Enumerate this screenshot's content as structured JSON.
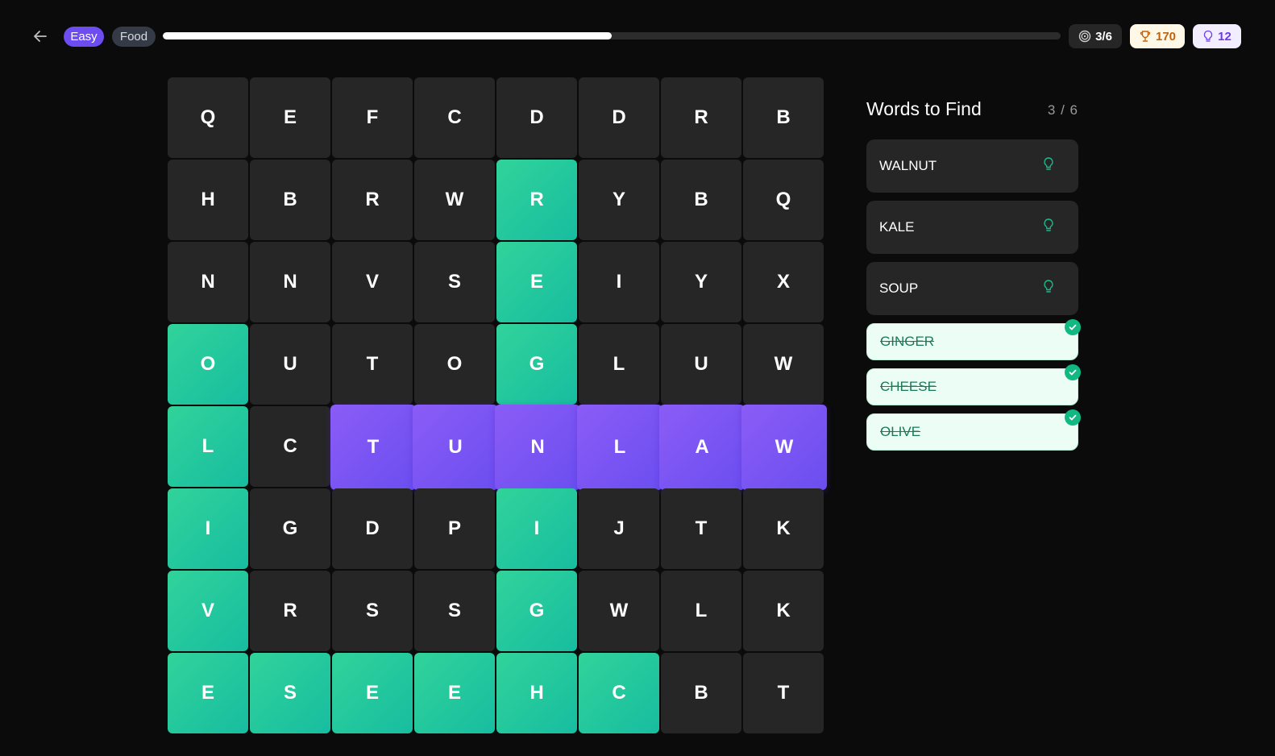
{
  "header": {
    "difficulty": "Easy",
    "category": "Food",
    "progress_fraction": 0.5,
    "found_count": "3/6",
    "score": "170",
    "hints": "12"
  },
  "grid": {
    "rows": [
      [
        "Q",
        "E",
        "F",
        "C",
        "D",
        "D",
        "R",
        "B"
      ],
      [
        "H",
        "B",
        "R",
        "W",
        "R",
        "Y",
        "B",
        "Q"
      ],
      [
        "N",
        "N",
        "V",
        "S",
        "E",
        "I",
        "Y",
        "X"
      ],
      [
        "O",
        "U",
        "T",
        "O",
        "G",
        "L",
        "U",
        "W"
      ],
      [
        "L",
        "C",
        "T",
        "U",
        "N",
        "L",
        "A",
        "W"
      ],
      [
        "I",
        "G",
        "D",
        "P",
        "I",
        "J",
        "T",
        "K"
      ],
      [
        "V",
        "R",
        "S",
        "S",
        "G",
        "W",
        "L",
        "K"
      ],
      [
        "E",
        "S",
        "E",
        "E",
        "H",
        "C",
        "B",
        "T"
      ]
    ],
    "found_cells": [
      [
        1,
        4
      ],
      [
        2,
        4
      ],
      [
        3,
        4
      ],
      [
        5,
        4
      ],
      [
        6,
        4
      ],
      [
        7,
        4
      ],
      [
        3,
        0
      ],
      [
        4,
        0
      ],
      [
        5,
        0
      ],
      [
        6,
        0
      ],
      [
        7,
        0
      ],
      [
        7,
        1
      ],
      [
        7,
        2
      ],
      [
        7,
        3
      ],
      [
        7,
        5
      ]
    ],
    "selected_cells": [
      [
        4,
        2
      ],
      [
        4,
        3
      ],
      [
        4,
        4
      ],
      [
        4,
        5
      ],
      [
        4,
        6
      ],
      [
        4,
        7
      ]
    ]
  },
  "sidebar": {
    "title": "Words to Find",
    "count": "3 / 6",
    "words": [
      {
        "text": "WALNUT",
        "found": false
      },
      {
        "text": "KALE",
        "found": false
      },
      {
        "text": "SOUP",
        "found": false
      },
      {
        "text": "GINGER",
        "found": true
      },
      {
        "text": "CHEESE",
        "found": true
      },
      {
        "text": "OLIVE",
        "found": true
      }
    ]
  },
  "colors": {
    "found": "#1fc79d",
    "selected": "#7c55f3",
    "cell": "#262626",
    "background": "#0b0b0b"
  }
}
